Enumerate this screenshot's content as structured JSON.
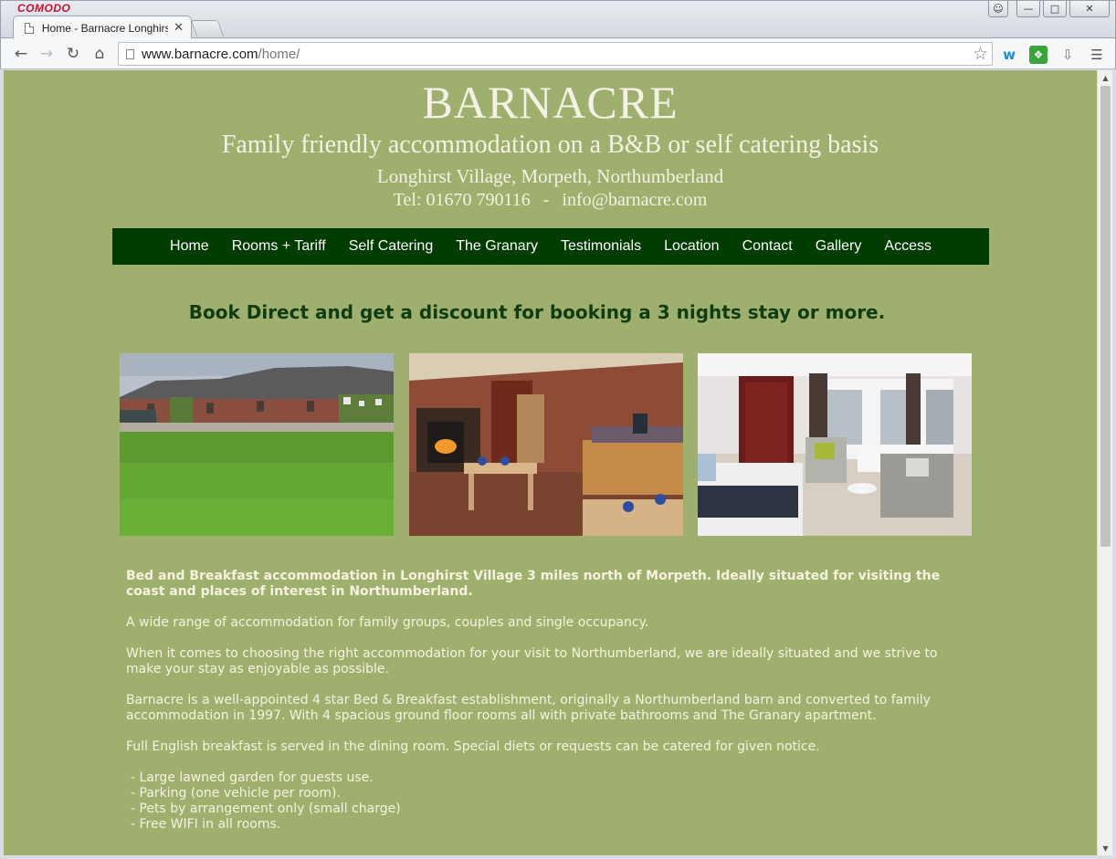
{
  "browser": {
    "brand": "COMODO",
    "tab_title": "Home - Barnacre Longhirst",
    "url_host": "www.barnacre.com",
    "url_path": "/home/"
  },
  "site": {
    "title": "BARNACRE",
    "tagline": "Family friendly accommodation on a B&B or self catering basis",
    "location": "Longhirst Village, Morpeth, Northumberland",
    "phone": "Tel: 01670 790116",
    "contact_sep": "-",
    "email": "info@barnacre.com"
  },
  "nav": {
    "items": [
      "Home",
      "Rooms + Tariff",
      "Self Catering",
      "The Granary",
      "Testimonials",
      "Location",
      "Contact",
      "Gallery",
      "Access"
    ]
  },
  "promo": "Book Direct and get a discount for booking a 3 nights stay or more.",
  "content": {
    "lead": "Bed and Breakfast accommodation in Longhirst Village 3 miles north of Morpeth. Ideally situated for visiting the coast and places of interest in Northumberland.",
    "p1": "A wide range of accommodation for family groups, couples and single occupancy.",
    "p2": "When it comes to choosing the right accommodation for your visit to Northumberland, we are ideally situated and we strive to make your stay as enjoyable as possible.",
    "p3": "Barnacre is a well-appointed 4 star Bed & Breakfast establishment, originally a Northumberland barn and converted to family accommodation in 1997.  With 4 spacious ground floor rooms all with private bathrooms and The Granary apartment.",
    "p4": "Full English breakfast is served in the dining room. Special diets or requests can be catered for given notice.",
    "features": [
      "- Large lawned garden for guests use.",
      "- Parking (one vehicle per room).",
      "- Pets by arrangement only (small charge)",
      "- Free WIFI in all rooms."
    ]
  },
  "colors": {
    "page_bg": "#9fb06e",
    "nav_bg": "#003b00",
    "promo_text": "#0f3d0f",
    "body_text": "#f5f3df"
  }
}
